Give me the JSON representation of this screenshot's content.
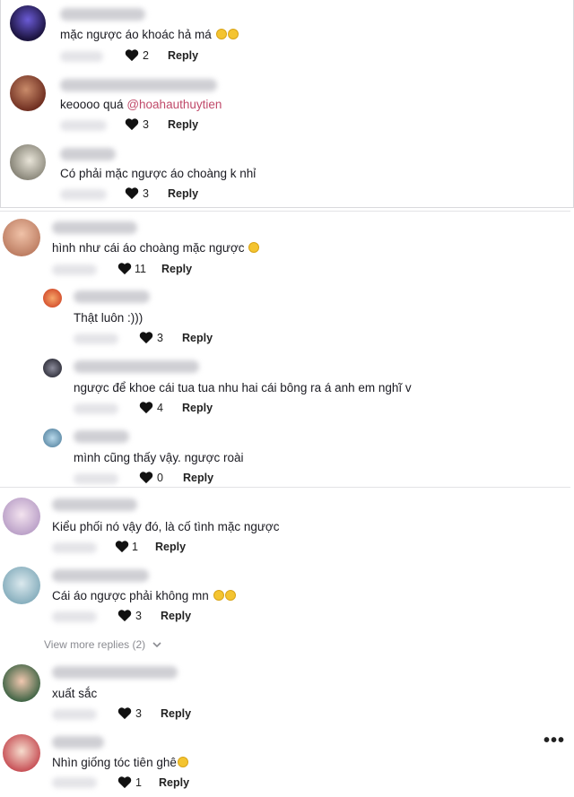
{
  "comments": [
    {
      "text": "mặc ngược áo khoác hả má",
      "likes": "2",
      "reply": "Reply"
    },
    {
      "text": "keoooo quá ",
      "mention": "@hoahauthuytien",
      "likes": "3",
      "reply": "Reply"
    },
    {
      "text": "Có phải mặc ngược áo choàng k nhỉ",
      "likes": "3",
      "reply": "Reply"
    },
    {
      "text": "hình như cái áo choàng mặc ngược",
      "likes": "11",
      "reply": "Reply"
    },
    {
      "text": "Thật luôn :)))",
      "likes": "3",
      "reply": "Reply"
    },
    {
      "text": "ngược để khoe cái tua tua nhu hai cái bông ra á anh em nghĩ v",
      "likes": "4",
      "reply": "Reply"
    },
    {
      "text": "mình cũng thấy vậy. ngược roài",
      "likes": "0",
      "reply": "Reply"
    },
    {
      "text": "Kiểu phối nó vậy đó, là cố tình mặc ngược",
      "likes": "1",
      "reply": "Reply"
    },
    {
      "text": "Cái áo ngược phải không mn",
      "likes": "3",
      "reply": "Reply"
    },
    {
      "text": "xuất sắc",
      "likes": "3",
      "reply": "Reply"
    },
    {
      "text": "Nhìn giống tóc tiên ghê",
      "likes": "1",
      "reply": "Reply"
    }
  ],
  "view_more": "View more replies (2)",
  "more_options": "•••",
  "icons": {
    "like": "heart-icon",
    "expand": "chevron-down-icon",
    "more": "more-options-icon"
  }
}
